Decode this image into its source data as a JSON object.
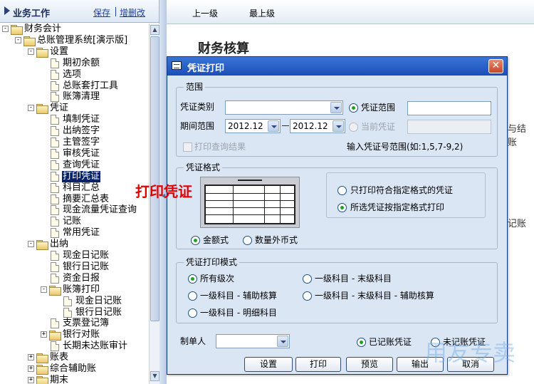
{
  "left_panel": {
    "title": "业务工作",
    "save_link": "保存",
    "edit_link": "增删改"
  },
  "tree": [
    {
      "label": "财务会计",
      "type": "folder",
      "toggle": "-"
    },
    {
      "label": "总账管理系统[演示版]",
      "type": "folder",
      "toggle": "-"
    },
    {
      "label": "设置",
      "type": "folder",
      "toggle": "-"
    },
    {
      "label": "期初余额",
      "type": "doc"
    },
    {
      "label": "选项",
      "type": "doc"
    },
    {
      "label": "总账套打工具",
      "type": "doc"
    },
    {
      "label": "账簿清理",
      "type": "doc"
    },
    {
      "label": "凭证",
      "type": "folder",
      "toggle": "-"
    },
    {
      "label": "填制凭证",
      "type": "doc"
    },
    {
      "label": "出纳签字",
      "type": "doc"
    },
    {
      "label": "主管签字",
      "type": "doc"
    },
    {
      "label": "审核凭证",
      "type": "doc"
    },
    {
      "label": "查询凭证",
      "type": "doc"
    },
    {
      "label": "打印凭证",
      "type": "doc",
      "selected": true
    },
    {
      "label": "科目汇总",
      "type": "doc"
    },
    {
      "label": "摘要汇总表",
      "type": "doc"
    },
    {
      "label": "现金流量凭证查询",
      "type": "doc"
    },
    {
      "label": "记账",
      "type": "doc"
    },
    {
      "label": "常用凭证",
      "type": "doc"
    },
    {
      "label": "出纳",
      "type": "folder",
      "toggle": "-"
    },
    {
      "label": "现金日记账",
      "type": "doc"
    },
    {
      "label": "银行日记账",
      "type": "doc"
    },
    {
      "label": "资金日报",
      "type": "doc"
    },
    {
      "label": "账簿打印",
      "type": "folder",
      "toggle": "-"
    },
    {
      "label": "现金日记账",
      "type": "doc"
    },
    {
      "label": "银行日记账",
      "type": "doc"
    },
    {
      "label": "支票登记簿",
      "type": "doc"
    },
    {
      "label": "银行对账",
      "type": "folder",
      "toggle": "+"
    },
    {
      "label": "长期未达账审计",
      "type": "doc"
    },
    {
      "label": "账表",
      "type": "folder",
      "toggle": "+"
    },
    {
      "label": "综合辅助账",
      "type": "folder",
      "toggle": "+"
    },
    {
      "label": "期末",
      "type": "folder",
      "toggle": "+"
    }
  ],
  "toolbar": {
    "up_level": "上一级",
    "top_level": "最上级"
  },
  "page": {
    "title": "财务核算",
    "side_text_1": "与结账",
    "side_text_2": "记账"
  },
  "overlay_caption": "打印凭证",
  "watermark": "用友专卖",
  "dialog": {
    "title": "凭证打印",
    "close_glyph": "✕",
    "range": {
      "group_title": "范围",
      "voucher_type_label": "凭证类别",
      "voucher_type_value": "",
      "voucher_range_label": "凭证范围",
      "voucher_range_value": "",
      "period_label": "期间范围",
      "period_from": "2012.12",
      "period_to": "2012.12",
      "current_voucher_label": "当前凭证",
      "print_query_label": "打印查询结果",
      "hint": "输入凭证号范围(如:1,5,7-9,2)"
    },
    "format": {
      "group_title": "凭证格式",
      "option_only_matching": "只打印符合指定格式的凭证",
      "option_selected_format": "所选凭证按指定格式打印",
      "amount_style": "金额式",
      "quantity_fx_style": "数量外币式"
    },
    "print_mode": {
      "group_title": "凭证打印模式",
      "all_levels": "所有级次",
      "level1_to_last": "一级科目 - 末级科目",
      "level1_auxiliary": "一级科目 - 辅助核算",
      "level1_last_auxiliary": "一级科目 - 末级科目 - 辅助核算",
      "level1_detail": "一级科目 - 明细科目"
    },
    "maker_label": "制单人",
    "maker_value": "",
    "posted_label": "已记账凭证",
    "unposted_label": "未记账凭证",
    "buttons": {
      "settings": "设置",
      "print": "打印",
      "preview": "预览",
      "export": "输出",
      "cancel": "取消"
    }
  }
}
